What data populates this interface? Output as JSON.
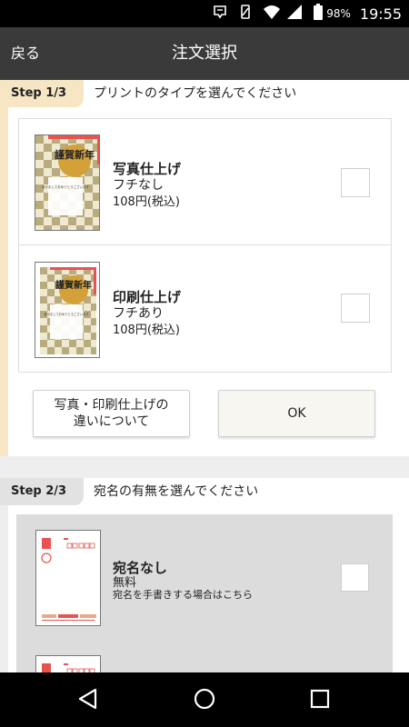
{
  "status_bar": {
    "battery": "98%",
    "time": "19:55",
    "icons": [
      "notification-icon",
      "vibrate-icon",
      "wifi-icon",
      "signal-icon",
      "battery-icon"
    ]
  },
  "header": {
    "back": "戻る",
    "title": "注文選択"
  },
  "step1": {
    "label": "Step 1/3",
    "question": "プリントのタイプを選んでください",
    "options": [
      {
        "title": "写真仕上げ",
        "subtitle": "フチなし",
        "price": "108円(税込)",
        "checked": false
      },
      {
        "title": "印刷仕上げ",
        "subtitle": "フチあり",
        "price": "108円(税込)",
        "checked": false
      }
    ],
    "card_text": {
      "greeting": "謹賀新年",
      "message": "あけましておめでとうございます"
    },
    "about_button": [
      "写真・印刷仕上げの",
      "違いについて"
    ],
    "ok_button": "OK"
  },
  "step2": {
    "label": "Step 2/3",
    "question": "宛名の有無を選んでください",
    "options": [
      {
        "title": "宛名なし",
        "subtitle": "無料",
        "note": "宛名を手書きする場合はこちら",
        "checked": false
      }
    ]
  },
  "nav": {
    "icons": [
      "back-nav-icon",
      "home-nav-icon",
      "recent-apps-icon"
    ]
  },
  "colors": {
    "header_bg": "#3a3a3a",
    "step1_accent": "#f6e6c4",
    "step2_accent": "#e2e2e2",
    "card_red": "#e8534f",
    "card_gold": "#d4a038",
    "card_check_dark": "#b8ab7e",
    "card_check_light": "#efe9d2"
  }
}
